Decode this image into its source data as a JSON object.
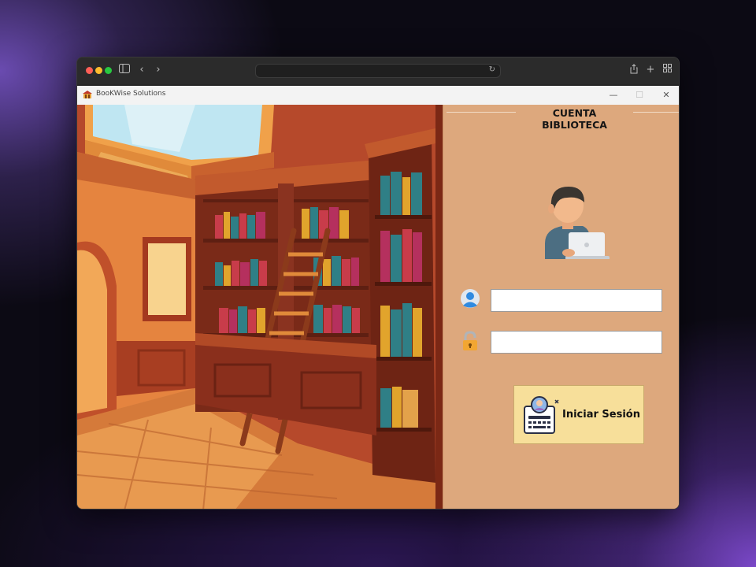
{
  "browser": {
    "address_text": "",
    "toolbar_icons": [
      "sidebar-icon",
      "back-icon",
      "forward-icon",
      "reload-icon",
      "share-icon",
      "new-tab-icon",
      "tab-overview-icon"
    ]
  },
  "app": {
    "title": "BooKWise Solutions",
    "window_controls": {
      "minimize": "—",
      "maximize": "☐",
      "close": "✕"
    }
  },
  "login": {
    "heading": "CUENTA BIBLIOTECA",
    "username_value": "",
    "password_value": "",
    "submit_label": "Iniciar Sesión"
  },
  "colors": {
    "panel_bg": "#dda87d",
    "button_bg": "#f7df9a",
    "field_bg": "#ffffff",
    "titlebar_bg": "#f3f3f3"
  }
}
